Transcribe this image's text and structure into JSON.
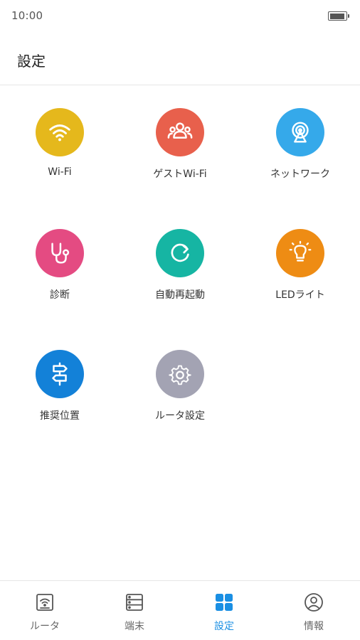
{
  "status_bar": {
    "time": "10:00"
  },
  "header": {
    "title": "設定"
  },
  "tiles": [
    {
      "label": "Wi-Fi",
      "icon": "wifi-icon",
      "color": "#e5b81c"
    },
    {
      "label": "ゲストWi-Fi",
      "icon": "guest-users-icon",
      "color": "#e8604c"
    },
    {
      "label": "ネットワーク",
      "icon": "network-antenna-icon",
      "color": "#35a9ea"
    },
    {
      "label": "診断",
      "icon": "stethoscope-icon",
      "color": "#e44b82"
    },
    {
      "label": "自動再起動",
      "icon": "refresh-icon",
      "color": "#16b5a3"
    },
    {
      "label": "LEDライト",
      "icon": "lightbulb-icon",
      "color": "#ee8c14"
    },
    {
      "label": "推奨位置",
      "icon": "signpost-icon",
      "color": "#1381d8"
    },
    {
      "label": "ルータ設定",
      "icon": "gear-icon",
      "color": "#a3a3b3"
    }
  ],
  "bottom_nav": {
    "active_color": "#1a8fe3",
    "items": [
      {
        "label": "ルータ",
        "icon": "router-icon",
        "active": false
      },
      {
        "label": "端末",
        "icon": "devices-icon",
        "active": false
      },
      {
        "label": "設定",
        "icon": "grid-icon",
        "active": true
      },
      {
        "label": "情報",
        "icon": "user-info-icon",
        "active": false
      }
    ]
  }
}
